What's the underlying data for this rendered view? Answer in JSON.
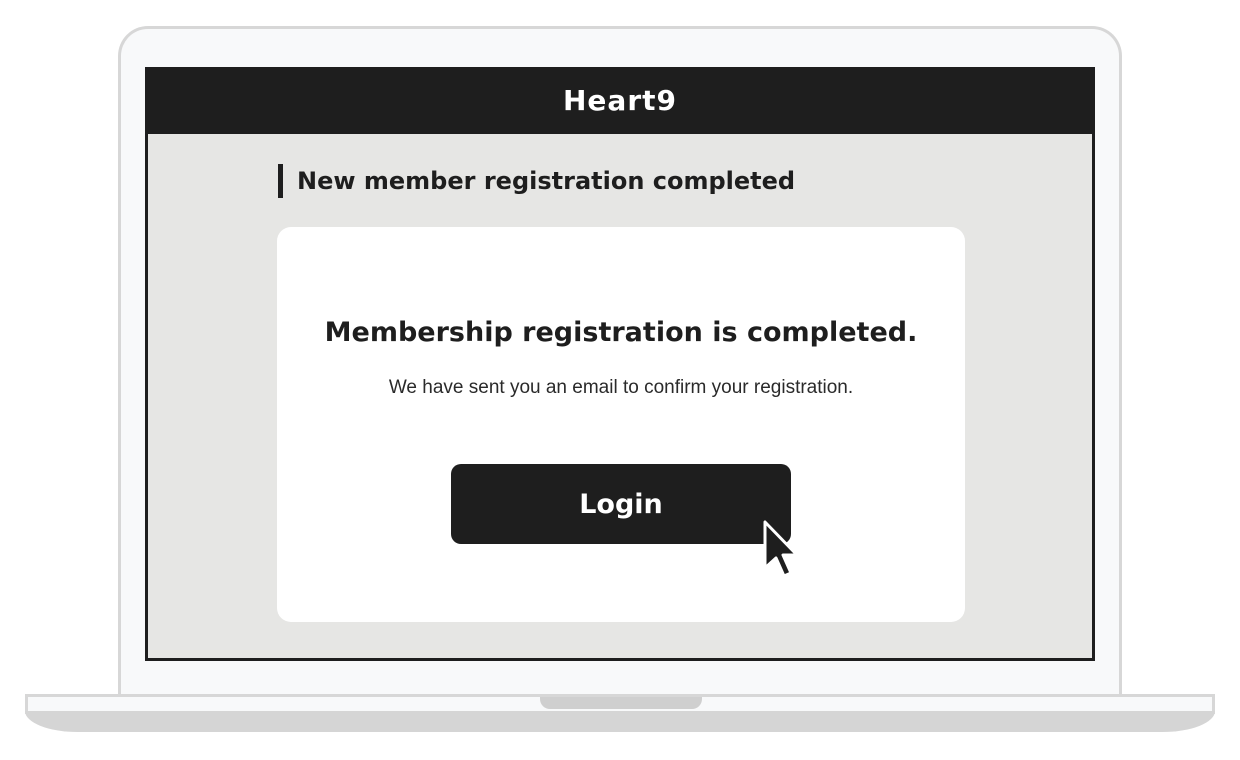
{
  "app": {
    "brand": "Heart9"
  },
  "page": {
    "heading": "New member registration completed"
  },
  "card": {
    "title": "Membership registration is completed.",
    "message": "We have sent you an email to confirm your registration.",
    "login_label": "Login"
  },
  "colors": {
    "header_bg": "#1e1e1e",
    "page_bg": "#e6e6e4",
    "button_bg": "#1e1e1e",
    "card_bg": "#ffffff"
  },
  "icons": {
    "cursor": "mouse-pointer-icon"
  }
}
